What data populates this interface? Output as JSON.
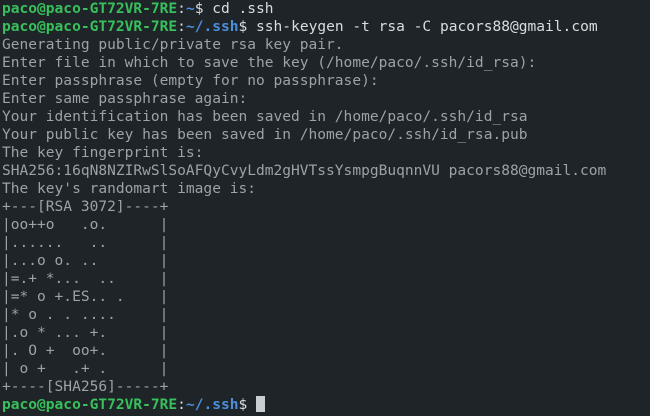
{
  "colors": {
    "background": "#1e2428",
    "output_text": "#9aa3a8",
    "prompt_user": "#38c05c",
    "prompt_path": "#4b8fdc",
    "command_text": "#d8dde0",
    "cursor": "#c9ced2"
  },
  "prompts": [
    {
      "user": "paco@paco-GT72VR-7RE",
      "sep": ":",
      "path": "~",
      "symbol": "$ ",
      "command": "cd .ssh"
    },
    {
      "user": "paco@paco-GT72VR-7RE",
      "sep": ":",
      "path": "~/.ssh",
      "symbol": "$ ",
      "command": "ssh-keygen -t rsa -C pacors88@gmail.com"
    },
    {
      "user": "paco@paco-GT72VR-7RE",
      "sep": ":",
      "path": "~/.ssh",
      "symbol": "$ ",
      "command": ""
    }
  ],
  "output": [
    "Generating public/private rsa key pair.",
    "Enter file in which to save the key (/home/paco/.ssh/id_rsa):",
    "Enter passphrase (empty for no passphrase):",
    "Enter same passphrase again:",
    "Your identification has been saved in /home/paco/.ssh/id_rsa",
    "Your public key has been saved in /home/paco/.ssh/id_rsa.pub",
    "The key fingerprint is:",
    "SHA256:16qN8NZIRwSlSoAFQyCvyLdm2gHVTssYsmpgBuqnnVU pacors88@gmail.com",
    "The key's randomart image is:",
    "+---[RSA 3072]----+",
    "|oo++o   .o.      |",
    "|......   ..      |",
    "|...o o. ..       |",
    "|=.+ *...  ..     |",
    "|=* o +.ES.. .    |",
    "|* o . . ....     |",
    "|.o * ... +.      |",
    "|. O +  oo+.      |",
    "| o +   .+ .      |",
    "+----[SHA256]-----+"
  ]
}
